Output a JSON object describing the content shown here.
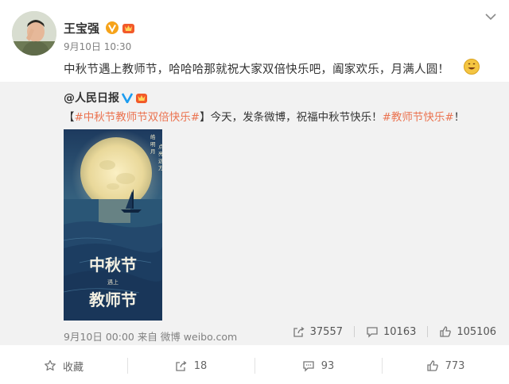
{
  "post": {
    "author": "王宝强",
    "time": "9月10日 10:30",
    "text": "中秋节遇上教师节，哈哈哈那就祝大家双倍快乐吧，阖家欢乐，月满人圆！"
  },
  "repost": {
    "author": "@人民日报",
    "text_open": "【",
    "tag1": "#中秋节教师节双倍快乐#",
    "text_mid": "】今天，发条微博，祝福中秋节快乐！",
    "tag2": "#教师节快乐#",
    "text_end": "！",
    "meta": "9月10日 00:00 来自 微博 weibo.com",
    "stats": {
      "forwards": "37557",
      "comments": "10163",
      "likes": "105106"
    },
    "poster": {
      "title_top": "中秋节",
      "small": "遇上",
      "title_bottom": "教师节",
      "vertical_1": "皓明月",
      "vertical_2": "点亮远方"
    }
  },
  "actions": {
    "favorite": "收藏",
    "forward": "18",
    "comment": "93",
    "like": "773"
  },
  "colors": {
    "tag": "#eb7350",
    "panel_bg": "#f2f2f2",
    "v_orange": "#f6a31a",
    "v_blue": "#1c9cf0"
  },
  "icons": [
    "chevron-down-icon",
    "v-verified-icon",
    "vip-crown-icon",
    "smile-emoji-icon",
    "forward-icon",
    "comment-icon",
    "like-icon",
    "star-icon"
  ]
}
